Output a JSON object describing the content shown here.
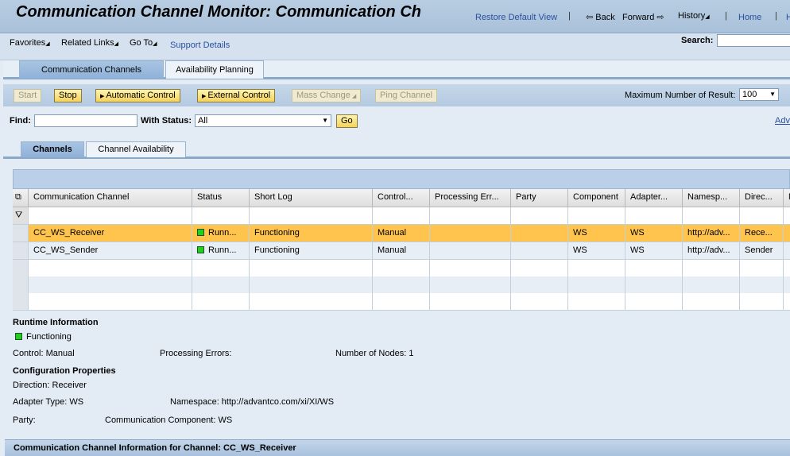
{
  "header": {
    "title": "Communication Channel Monitor: Communication Ch",
    "restore": "Restore Default View",
    "back": "Back",
    "forward": "Forward",
    "history": "History",
    "home": "Home",
    "help": "H"
  },
  "menu": {
    "favorites": "Favorites",
    "related": "Related Links",
    "goto": "Go To",
    "support": "Support Details",
    "search_label": "Search:"
  },
  "tabs": [
    "Communication Channels",
    "Availability Planning"
  ],
  "toolbar": {
    "start": "Start",
    "stop": "Stop",
    "auto": "Automatic Control",
    "external": "External Control",
    "mass": "Mass Change",
    "ping": "Ping Channel",
    "max_label": "Maximum Number of Result:",
    "max_value": "100"
  },
  "find": {
    "label": "Find:",
    "value": "",
    "status_label": "With Status:",
    "status_value": "All",
    "go": "Go",
    "adv": "Adv"
  },
  "subtabs": [
    "Channels",
    "Channel Availability"
  ],
  "table": {
    "columns": [
      "Communication Channel",
      "Status",
      "Short Log",
      "Control...",
      "Processing Err...",
      "Party",
      "Component",
      "Adapter...",
      "Namesp...",
      "Direc...",
      "N"
    ],
    "rows": [
      [
        "CC_WS_Receiver",
        "Runn...",
        "Functioning",
        "Manual",
        "",
        "",
        "WS",
        "WS",
        "http://adv...",
        "Rece...",
        ""
      ],
      [
        "CC_WS_Sender",
        "Runn...",
        "Functioning",
        "Manual",
        "",
        "",
        "WS",
        "WS",
        "http://adv...",
        "Sender",
        ""
      ]
    ],
    "status_color": "#1ed11e",
    "selected_color": "#ffc44d"
  },
  "details": {
    "runtime_title": "Runtime Information",
    "functioning": "Functioning",
    "control": "Control: Manual",
    "proc_errors": "Processing Errors:",
    "nodes": "Number of Nodes: 1",
    "config_title": "Configuration Properties",
    "direction": "Direction: Receiver",
    "adapter": "Adapter Type: WS",
    "namespace": "Namespace: http://advantco.com/xi/XI/WS",
    "party": "Party:",
    "component": "Communication Component: WS"
  },
  "footer": "Communication Channel Information for Channel: CC_WS_Receiver"
}
